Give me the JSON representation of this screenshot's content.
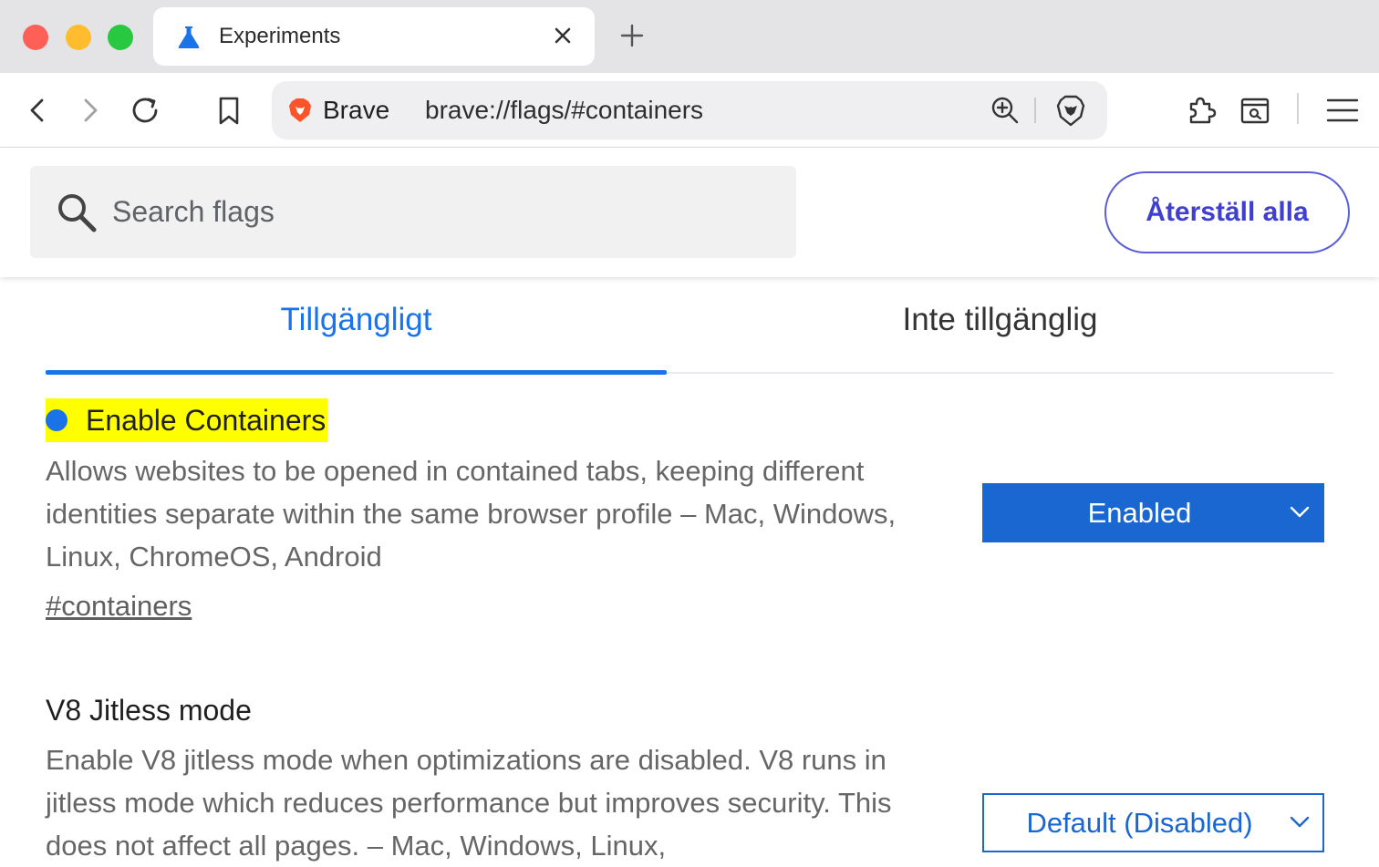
{
  "window": {
    "tab_title": "Experiments",
    "icons": [
      "flask-icon",
      "close-icon",
      "plus-icon"
    ]
  },
  "toolbar": {
    "brand": "Brave",
    "url": "brave://flags/#containers",
    "icons": [
      "back-icon",
      "forward-icon",
      "reload-icon",
      "bookmark-icon",
      "zoom-icon",
      "brave-shields-icon",
      "extensions-icon",
      "tab-search-icon",
      "menu-icon"
    ]
  },
  "search": {
    "placeholder": "Search flags",
    "value": "",
    "reset_label": "Återställ alla"
  },
  "tabs": {
    "available": "Tillgängligt",
    "unavailable": "Inte tillgänglig"
  },
  "experiments": [
    {
      "title": "Enable Containers",
      "highlighted": true,
      "description": "Allows websites to be opened in contained tabs, keeping different identities separate within the same browser profile – Mac, Windows, Linux, ChromeOS, Android",
      "link": "#containers",
      "state": "Enabled"
    },
    {
      "title": "V8 Jitless mode",
      "highlighted": false,
      "description": "Enable V8 jitless mode when optimizations are disabled. V8 runs in jitless mode which reduces performance but improves security. This does not affect all pages. – Mac, Windows, Linux,",
      "state": "Default (Disabled)"
    }
  ],
  "colors": {
    "accent": "#1a73e8",
    "select_blue": "#1a67d2",
    "reset_button": "#3f3fd0",
    "highlight": "#ffff00"
  }
}
